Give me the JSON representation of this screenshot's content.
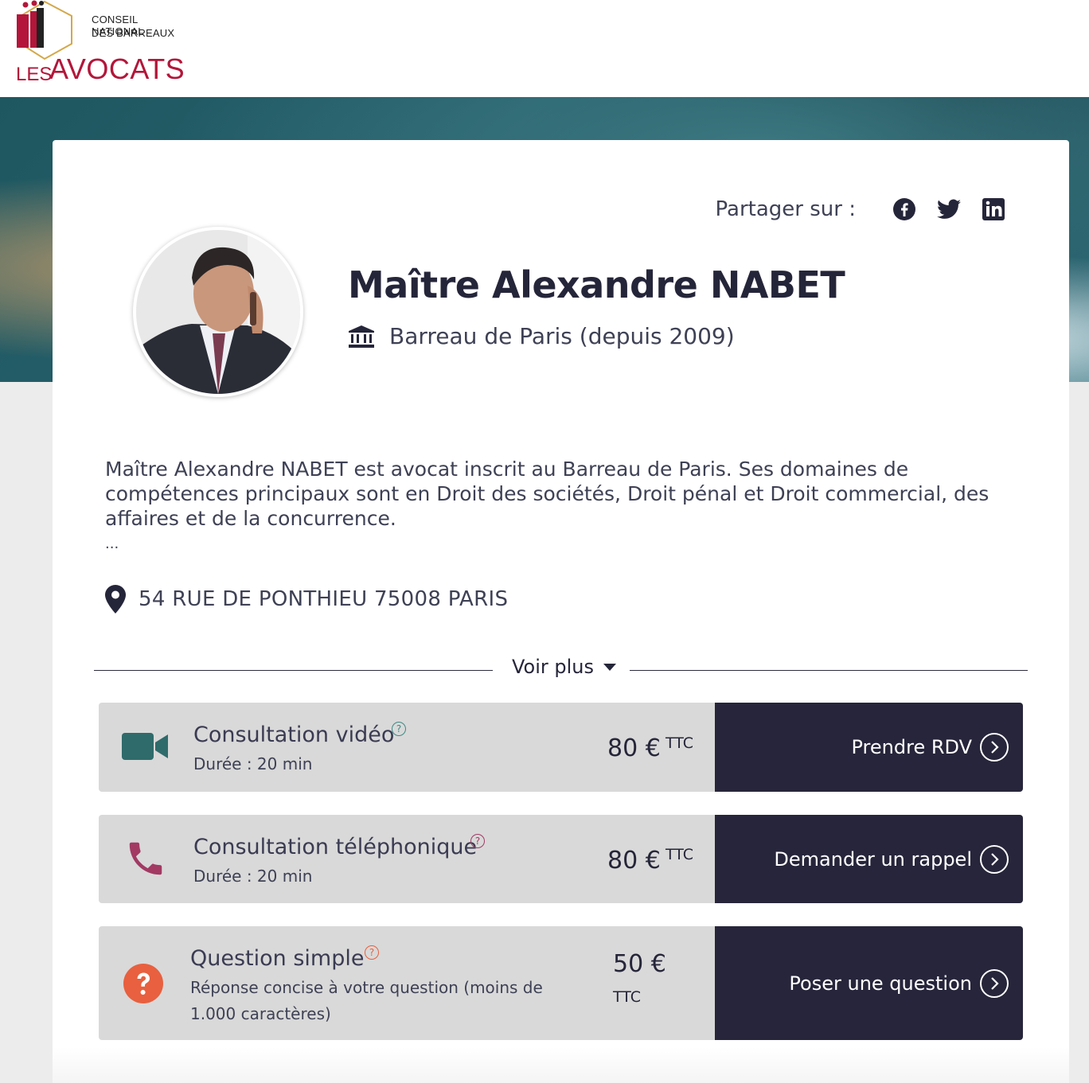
{
  "logo": {
    "line1": "CONSEIL NATIONAL",
    "line2": "DES BARREAUX",
    "les": "LES",
    "avocats": "AVOCATS"
  },
  "share": {
    "label": "Partager sur :",
    "icons": [
      "facebook-icon",
      "twitter-icon",
      "linkedin-icon"
    ]
  },
  "profile": {
    "name": "Maître Alexandre NABET",
    "bar": "Barreau de Paris (depuis 2009)",
    "bio": "Maître Alexandre NABET est avocat inscrit au Barreau de Paris. Ses domaines de compétences principaux sont en Droit des sociétés, Droit pénal et Droit commercial, des affaires et de la concurrence.",
    "bio_more": "...",
    "address": "54 RUE DE PONTHIEU 75008 PARIS",
    "voir_plus": "Voir plus"
  },
  "offers": [
    {
      "title": "Consultation vidéo",
      "subtitle": "Durée : 20 min",
      "price": "80 €",
      "ttc": "TTC",
      "button": "Prendre RDV",
      "icon": "video-camera-icon",
      "icon_color": "#2f6b6b",
      "help_color": "#3e8a85"
    },
    {
      "title": "Consultation téléphonique",
      "subtitle": "Durée : 20 min",
      "price": "80 €",
      "ttc": "TTC",
      "button": "Demander un rappel",
      "icon": "phone-icon",
      "icon_color": "#a23a63",
      "help_color": "#a23a63"
    },
    {
      "title": "Question simple",
      "subtitle": "Réponse concise à votre question (moins de 1.000 caractères)",
      "price": "50 €",
      "ttc": "TTC",
      "button": "Poser une question",
      "icon": "question-icon",
      "icon_color": "#e8603f",
      "help_color": "#e8603f"
    }
  ],
  "colors": {
    "brand_red": "#b3163a",
    "button_dark": "#26253b",
    "offer_bg": "#d9d9d9"
  }
}
